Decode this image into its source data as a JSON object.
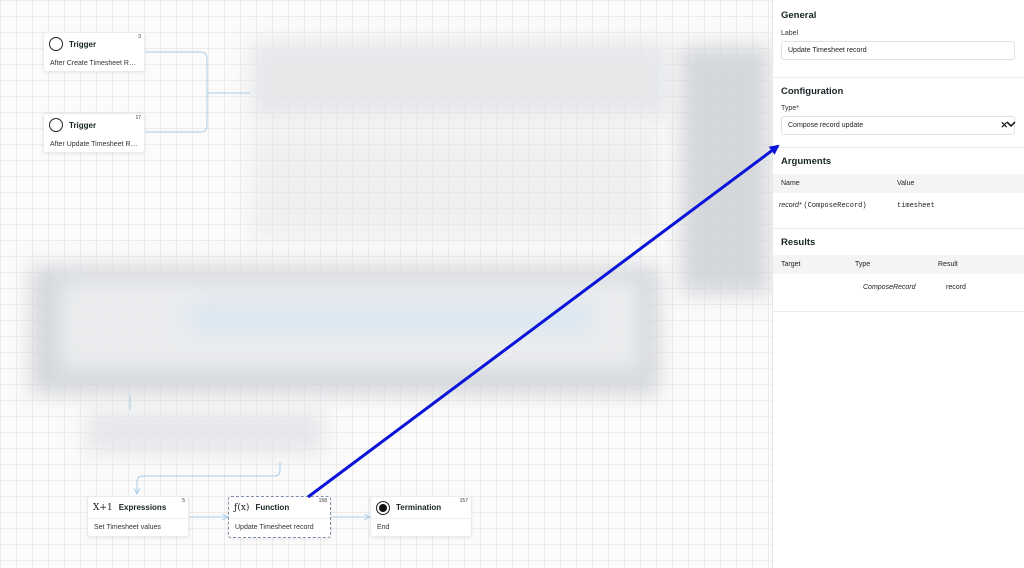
{
  "nodes": {
    "trigger1": {
      "title": "Trigger",
      "subtitle": "After Create Timesheet Re...",
      "id": "3"
    },
    "trigger2": {
      "title": "Trigger",
      "subtitle": "After Update Timesheet Re...",
      "id": "17"
    },
    "expressions": {
      "icon": "X+1",
      "title": "Expressions",
      "subtitle": "Set Timesheet values",
      "id": "5"
    },
    "function": {
      "icon": "ƒ(x)",
      "title": "Function",
      "subtitle": "Update Timesheet record",
      "id": "158"
    },
    "termination": {
      "title": "Termination",
      "subtitle": "End",
      "id": "157"
    }
  },
  "panel": {
    "general": {
      "heading": "General",
      "label_caption": "Label",
      "label_value": "Update Timesheet record"
    },
    "configuration": {
      "heading": "Configuration",
      "type_caption": "Type*",
      "type_value": "Compose record update"
    },
    "arguments": {
      "heading": "Arguments",
      "columns": [
        "Name",
        "Value"
      ],
      "row": {
        "name": "record*",
        "type": "(ComposeRecord)",
        "value": "timesheet"
      }
    },
    "results": {
      "heading": "Results",
      "columns": [
        "Target",
        "Type",
        "Result"
      ],
      "row": {
        "target": "",
        "type": "ComposeRecord",
        "result": "record"
      }
    }
  },
  "colors": {
    "annotation_arrow": "#0a14d8",
    "connector": "#a9cde6"
  }
}
